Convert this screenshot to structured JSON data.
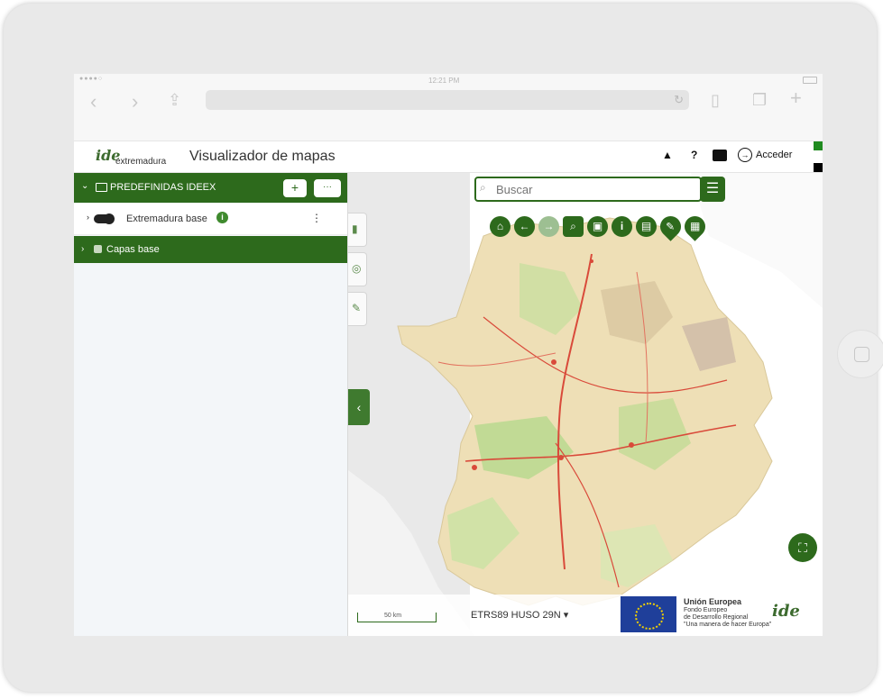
{
  "status_bar": {
    "signal": "●●●●○",
    "time": "12:21 PM"
  },
  "safari": {
    "back_icon": "chevron-left-icon",
    "forward_icon": "chevron-right-icon",
    "share_icon": "share-icon",
    "reload_icon": "reload-icon",
    "bookmarks_icon": "book-icon",
    "tabs_icon": "tabs-icon",
    "new_tab_icon": "plus-icon"
  },
  "header": {
    "logo_mark": "ide",
    "logo_text": "extremadura",
    "title": "Visualizador de mapas",
    "warning_symbol": "▲",
    "help_symbol": "?",
    "login_label": "Acceder",
    "accent_green": "#1f8a1f"
  },
  "sidebar": {
    "group": {
      "label": "PREDEFINIDAS IDEEX",
      "add_label": "+",
      "more_label": "···"
    },
    "layers": [
      {
        "name": "Extremadura base",
        "enabled": true,
        "info": "i"
      }
    ],
    "base_group": {
      "label": "Capas base"
    },
    "primary_color": "#2d6a1c"
  },
  "map": {
    "search_placeholder": "Buscar",
    "tools": [
      "home",
      "back",
      "forward",
      "zoom-box",
      "print",
      "info",
      "image",
      "measure-pin",
      "grid-pin"
    ],
    "scale_label": "50 km",
    "projection": "ETRS89 HUSO 29N ▾",
    "eu_title": "Unión Europea",
    "eu_line1": "Fondo Europeo",
    "eu_line2": "de Desarrollo Regional",
    "eu_line3": "\"Una manera de hacer Europa\"",
    "footer_logo": "ide"
  }
}
